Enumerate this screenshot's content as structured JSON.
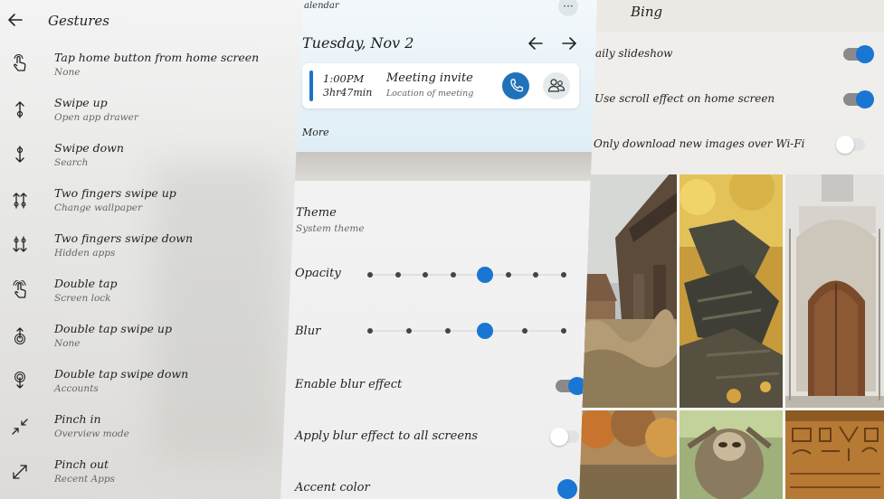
{
  "gestures": {
    "title": "Gestures",
    "items": [
      {
        "label": "Tap home button from home screen",
        "value": "None",
        "icon": "hand-tap-icon"
      },
      {
        "label": "Swipe up",
        "value": "Open app drawer",
        "icon": "swipe-up-icon"
      },
      {
        "label": "Swipe down",
        "value": "Search",
        "icon": "swipe-down-icon"
      },
      {
        "label": "Two fingers swipe up",
        "value": "Change wallpaper",
        "icon": "two-finger-swipe-up-icon"
      },
      {
        "label": "Two fingers swipe down",
        "value": "Hidden apps",
        "icon": "two-finger-swipe-down-icon"
      },
      {
        "label": "Double tap",
        "value": "Screen lock",
        "icon": "double-tap-icon"
      },
      {
        "label": "Double tap swipe up",
        "value": "None",
        "icon": "double-tap-swipe-up-icon"
      },
      {
        "label": "Double tap swipe down",
        "value": "Accounts",
        "icon": "double-tap-swipe-down-icon"
      },
      {
        "label": "Pinch in",
        "value": "Overview mode",
        "icon": "pinch-in-icon"
      },
      {
        "label": "Pinch out",
        "value": "Recent Apps",
        "icon": "pinch-out-icon"
      }
    ]
  },
  "calendar": {
    "app_label": "alendar",
    "more_menu": "···",
    "date": "Tuesday, Nov 2",
    "event": {
      "time": "1:00PM",
      "duration": "3hr47min",
      "title": "Meeting invite",
      "location": "Location of meeting"
    },
    "more_label": "More"
  },
  "settings": {
    "theme_label": "Theme",
    "theme_value": "System theme",
    "opacity_label": "Opacity",
    "opacity_level": 0.6,
    "blur_label": "Blur",
    "blur_level": 0.6,
    "enable_blur_label": "Enable blur effect",
    "enable_blur_on": true,
    "apply_blur_label": "Apply blur effect to all screens",
    "apply_blur_on": false,
    "accent_label": "Accent color",
    "accent_color": "#1976d2"
  },
  "bing": {
    "title": "Bing",
    "options": [
      {
        "label": "aily slideshow",
        "on": true
      },
      {
        "label": "Use scroll effect on home screen",
        "on": true
      },
      {
        "label": "Only download new images over Wi-Fi",
        "on": false
      }
    ]
  },
  "colors": {
    "accent": "#1976d2",
    "call_button": "#1f72b8"
  }
}
